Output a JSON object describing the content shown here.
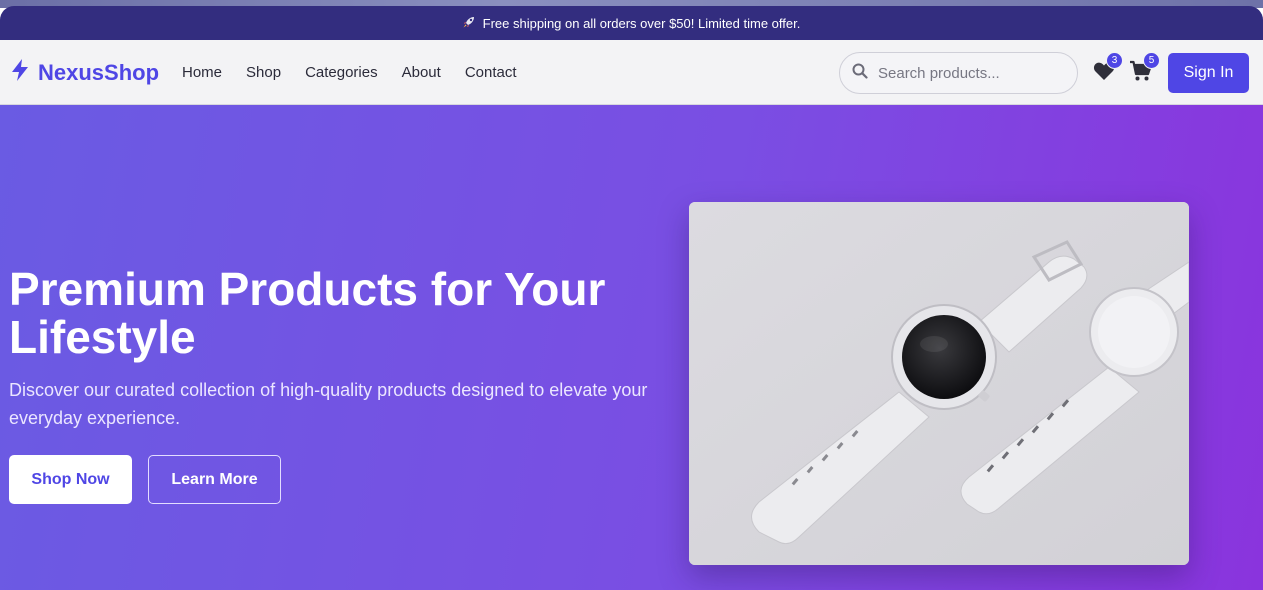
{
  "announcement": {
    "icon": "rocket-icon",
    "text": "Free shipping on all orders over $50! Limited time offer."
  },
  "brand": {
    "name": "NexusShop",
    "icon": "bolt-icon",
    "color": "#4f46e5"
  },
  "nav": {
    "items": [
      {
        "label": "Home"
      },
      {
        "label": "Shop"
      },
      {
        "label": "Categories"
      },
      {
        "label": "About"
      },
      {
        "label": "Contact"
      }
    ]
  },
  "search": {
    "placeholder": "Search products...",
    "value": "",
    "icon": "search-icon"
  },
  "wishlist": {
    "icon": "heart-icon",
    "count": "3"
  },
  "cart": {
    "icon": "cart-icon",
    "count": "5"
  },
  "signin": {
    "label": "Sign In"
  },
  "hero": {
    "title": "Premium Products for Your Lifestyle",
    "subtitle": "Discover our curated collection of high-quality products designed to elevate your everyday experience.",
    "primary_cta": "Shop Now",
    "secondary_cta": "Learn More",
    "image": "smartwatch-product-image"
  },
  "colors": {
    "accent": "#4f46e5",
    "announcement_bg": "#332d7f",
    "hero_gradient_start": "#6a5be3",
    "hero_gradient_end": "#8a34dd"
  }
}
